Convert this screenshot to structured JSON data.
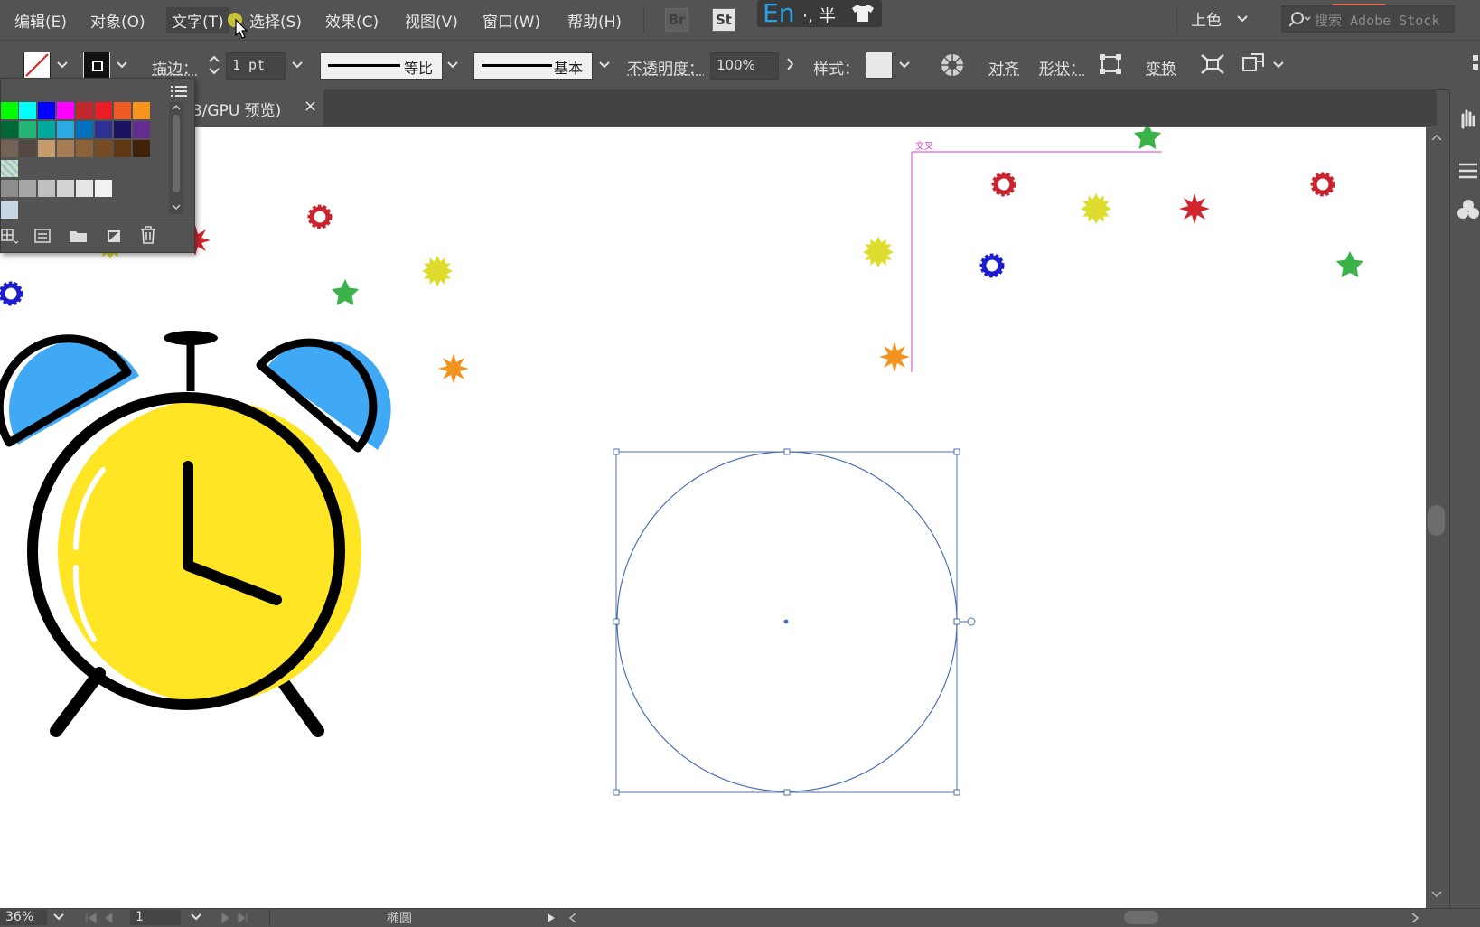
{
  "menubar": {
    "items": [
      "编辑(E)",
      "对象(O)",
      "文字(T)",
      "选择(S)",
      "效果(C)",
      "视图(V)",
      "窗口(W)",
      "帮助(H)"
    ],
    "bridge_badge": "Br",
    "stock_badge": "St",
    "ime_mode": "En",
    "ime_extra": "·, 半",
    "workspace": "上色",
    "search_placeholder": "搜索 Adobe Stock"
  },
  "controlbar": {
    "stroke_label": "描边：",
    "stroke_weight": "1 pt",
    "profile_label": "等比",
    "brush_label": "基本",
    "opacity_label": "不透明度：",
    "opacity_value": "100%",
    "style_label": "样式：",
    "align_label": "对齐",
    "shape_label": "形状：",
    "transform_label": "变换"
  },
  "document_tab": {
    "label": "B/GPU 预览)",
    "close": "×"
  },
  "canvas": {
    "guide_label": "交叉"
  },
  "statusbar": {
    "zoom": "36%",
    "artboard": "1",
    "selection": "椭圆"
  },
  "colors": {
    "ui_bg": "#535353",
    "canvas": "#ffffff",
    "clock_yellow": "#ffe523",
    "clock_bell_blue": "#3fa9f5",
    "selection_blue": "#4d6fb3",
    "guide_magenta": "#d23fd2"
  }
}
